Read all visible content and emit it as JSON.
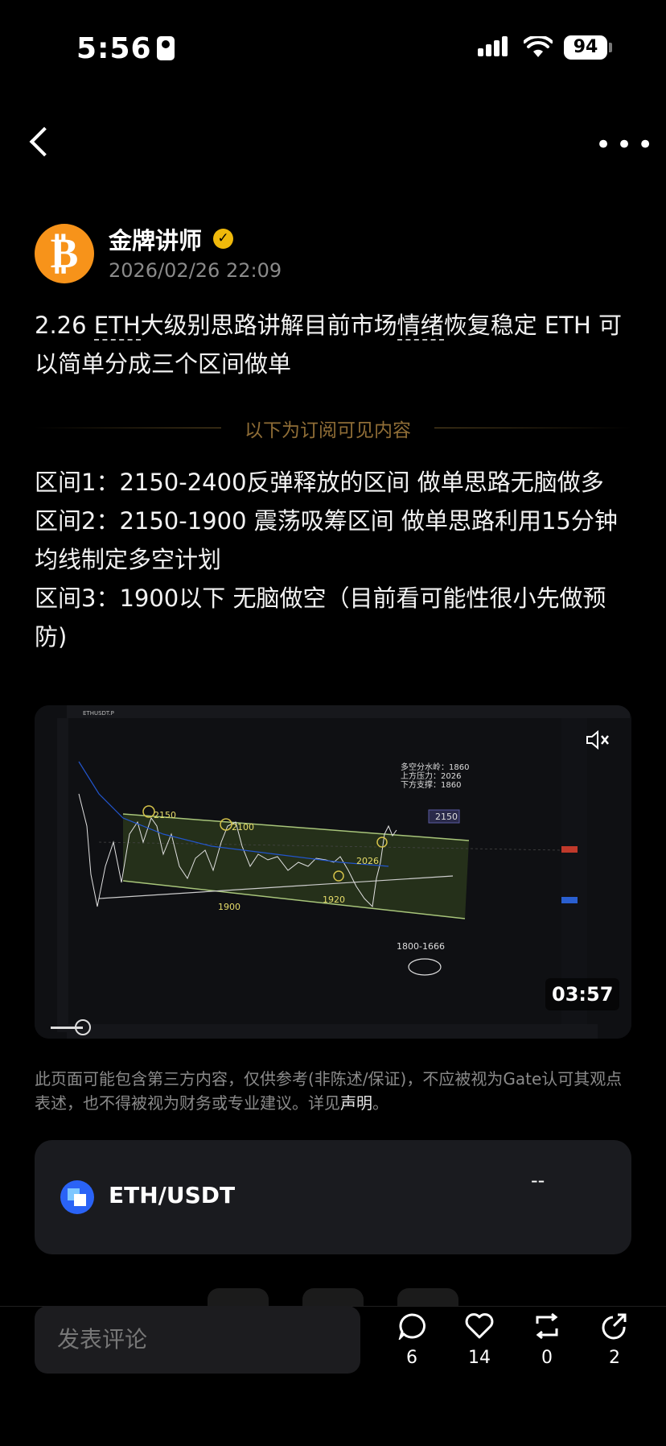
{
  "status_bar": {
    "time": "5:56",
    "battery": "94"
  },
  "author": {
    "name": "金牌讲师",
    "avatar_letter": "₿",
    "timestamp": "2026/02/26 22:09"
  },
  "post": {
    "title_prefix": "2.26 ",
    "title_eth": "ETH",
    "title_mid": "大级别思路讲解目前市场",
    "title_emotion": "情绪",
    "title_rest": "恢复稳定 ETH 可以简单分成三个区间做单",
    "subscriber_divider": "以下为订阅可见内容",
    "paragraphs": [
      "区间1：2150-2400反弹释放的区间 做单思路无脑做多",
      "区间2：2150-1900 震荡吸筹区间 做单思路利用15分钟均线制定多空计划",
      "区间3：1900以下 无脑做空（目前看可能性很小先做预防)"
    ]
  },
  "video": {
    "duration": "03:57",
    "chart_symbol": "ETHUSDT.P",
    "note_lines": [
      "多空分水岭：1860",
      "上方压力：2026",
      "下方支撑：1860"
    ],
    "labels": {
      "l2150a": "2150",
      "l2100": "2100",
      "l1900": "1900",
      "l1920": "1920",
      "l2026": "2026",
      "l2150box": "2150",
      "l1800": "1800-1666"
    }
  },
  "disclaimer": {
    "text": "此页面可能包含第三方内容，仅供参考(非陈述/保证)，不应被视为Gate认可其观点表述，也不得被视为财务或专业建议。详见",
    "link": "声明",
    "end": "。"
  },
  "ticker": {
    "pair": "ETH/USDT",
    "price": "--"
  },
  "bottom_bar": {
    "comment_placeholder": "发表评论",
    "comments": "6",
    "likes": "14",
    "reposts": "0",
    "shares": "2"
  }
}
